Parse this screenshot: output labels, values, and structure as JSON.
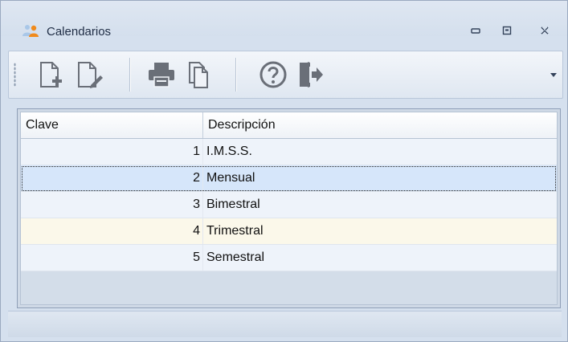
{
  "window": {
    "title": "Calendarios",
    "icon": "users-icon",
    "controls": [
      "minimize-icon",
      "restore-icon",
      "close-icon"
    ]
  },
  "toolbar": {
    "buttons": [
      {
        "name": "new-document",
        "icon": "document-add-icon"
      },
      {
        "name": "edit-document",
        "icon": "document-edit-icon"
      },
      {
        "name": "print",
        "icon": "printer-icon"
      },
      {
        "name": "copy",
        "icon": "copy-icon"
      },
      {
        "name": "help",
        "icon": "help-icon"
      },
      {
        "name": "exit",
        "icon": "exit-door-icon"
      }
    ],
    "overflow_icon": "chevron-down-icon"
  },
  "grid": {
    "columns": [
      "Clave",
      "Descripción"
    ],
    "rows": [
      {
        "clave": "1",
        "descripcion": "I.M.S.S."
      },
      {
        "clave": "2",
        "descripcion": "Mensual"
      },
      {
        "clave": "3",
        "descripcion": "Bimestral"
      },
      {
        "clave": "4",
        "descripcion": "Trimestral"
      },
      {
        "clave": "5",
        "descripcion": "Semestral"
      }
    ],
    "selected_index": 1
  },
  "colors": {
    "row_odd": "#eef3fa",
    "row_even": "#fdfdfb",
    "row_alt_warm": "#fbf8ea",
    "row_selected": "#d6e6fa",
    "toolbar_icon": "#6a6f78"
  }
}
